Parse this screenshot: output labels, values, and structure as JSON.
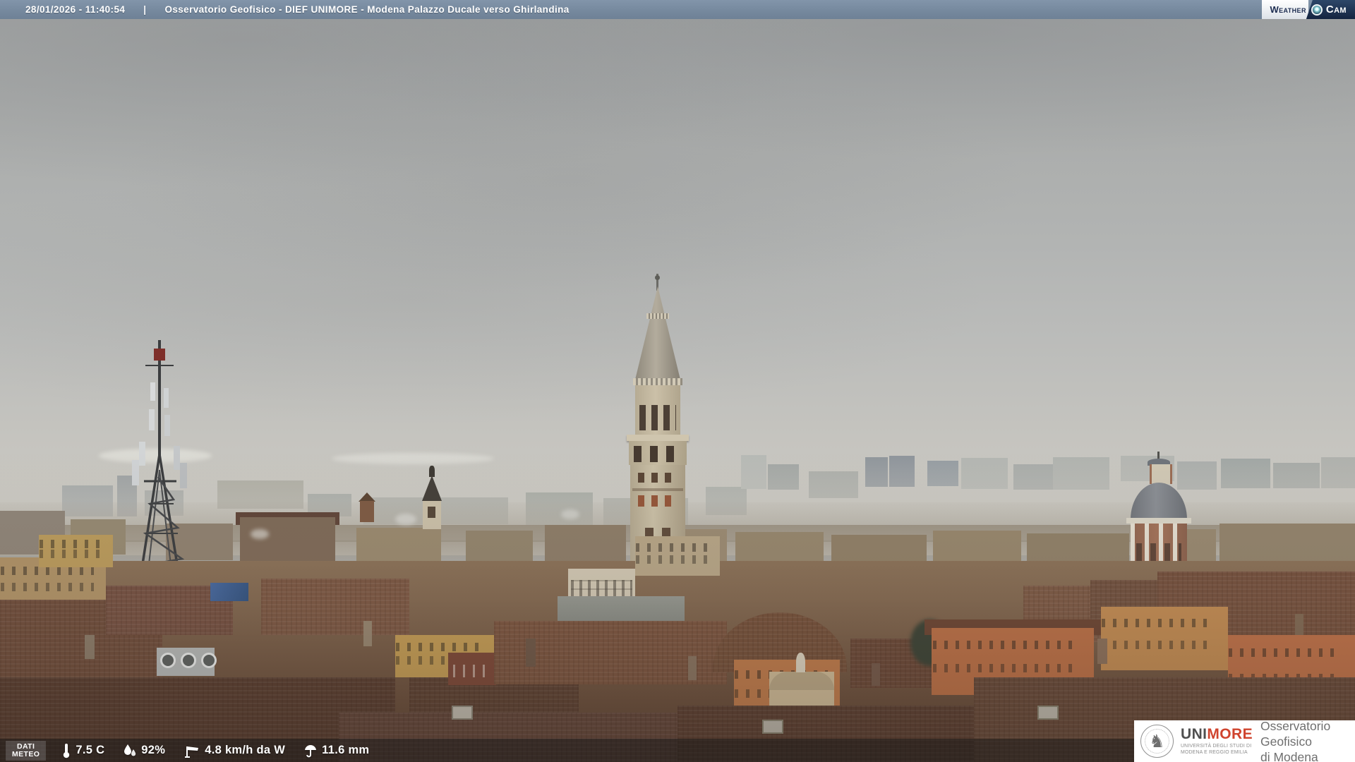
{
  "header": {
    "timestamp": "28/01/2026 - 11:40:54",
    "separator": "|",
    "title": "Osservatorio Geofisico - DIEF UNIMORE - Modena Palazzo Ducale verso Ghirlandina"
  },
  "weathercam": {
    "weather": "Weather",
    "cam": "Cam"
  },
  "meteo": {
    "label_line1": "DATI",
    "label_line2": "METEO",
    "temperature": "7.5 C",
    "humidity": "92%",
    "wind": "4.8 km/h da W",
    "rain": "11.6 mm",
    "icons": [
      "thermometer-icon",
      "humidity-icon",
      "wind-icon",
      "rain-umbrella-icon"
    ]
  },
  "credit": {
    "brand_uni": "UNI",
    "brand_more": "MORE",
    "university_line1": "UNIVERSITÀ DEGLI STUDI DI",
    "university_line2": "MODENA E REGGIO EMILIA",
    "org_line1": "Osservatorio Geofisico",
    "org_line2": "di Modena"
  },
  "scene": {
    "landmarks": [
      "telecom-lattice-tower",
      "ghirlandina-tower",
      "church-dome",
      "bell-tower",
      "historic-rooftops",
      "distant-skyline"
    ],
    "colors": {
      "top_bar": "#75889d",
      "sky_top": "#a3a5a5",
      "sky_horizon": "#cbc9c2",
      "roof_terracotta": "#6f4d3b",
      "facade_ochre": "#c19a54",
      "facade_orange": "#bd7a4b",
      "stone_cream": "#c6bba3",
      "dome_lead": "#7d8187",
      "brand_red": "#d0442e",
      "logo_navy": "#142440"
    }
  }
}
